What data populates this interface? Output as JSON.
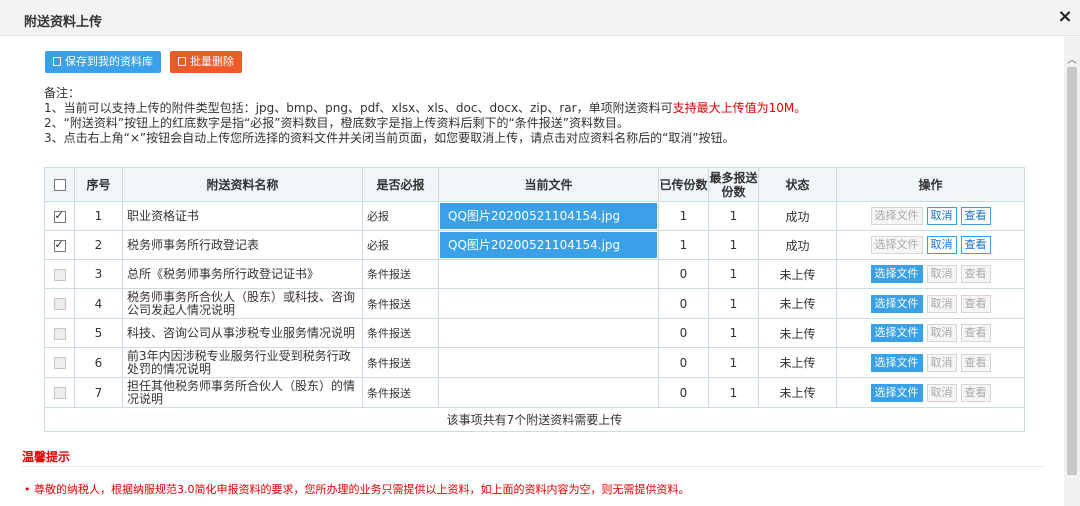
{
  "dialog": {
    "title": "附送资料上传",
    "close_glyph": "×"
  },
  "toolbar": {
    "save_label": "保存到我的资料库",
    "delete_label": "批量删除"
  },
  "notes": {
    "heading": "备注：",
    "line1_prefix": "1、当前可以支持上传的附件类型包括：jpg、bmp、png、pdf、xlsx、xls、doc、docx、zip、rar，单项附送资料可",
    "line1_highlight": "支持最大上传值为10M。",
    "line2": "2、“附送资料”按钮上的红底数字是指“必报”资料数目，橙底数字是指上传资料后剩下的“条件报送”资料数目。",
    "line3": "3、点击右上角“×”按钮会自动上传您所选择的资料文件并关闭当前页面，如您要取消上传，请点击对应资料名称后的“取消”按钮。"
  },
  "table": {
    "headers": {
      "seq": "序号",
      "name": "附送资料名称",
      "required": "是否必报",
      "current_file": "当前文件",
      "uploaded": "已传份数",
      "max": "最多报送份数",
      "status": "状态",
      "ops": "操作"
    },
    "rows": [
      {
        "seq": "1",
        "name": "职业资格证书",
        "required": "必报",
        "file": "QQ图片20200521104154.jpg",
        "uploaded": "1",
        "max": "1",
        "status": "成功",
        "op_select": "选择文件",
        "op_cancel": "取消",
        "op_view": "查看"
      },
      {
        "seq": "2",
        "name": "税务师事务所行政登记表",
        "required": "必报",
        "file": "QQ图片20200521104154.jpg",
        "uploaded": "1",
        "max": "1",
        "status": "成功",
        "op_select": "选择文件",
        "op_cancel": "取消",
        "op_view": "查看"
      },
      {
        "seq": "3",
        "name": "总所《税务师事务所行政登记证书》",
        "required": "条件报送",
        "file": "",
        "uploaded": "0",
        "max": "1",
        "status": "未上传",
        "op_select": "选择文件",
        "op_cancel": "取消",
        "op_view": "查看"
      },
      {
        "seq": "4",
        "name": "税务师事务所合伙人（股东）或科技、咨询公司发起人情况说明",
        "required": "条件报送",
        "file": "",
        "uploaded": "0",
        "max": "1",
        "status": "未上传",
        "op_select": "选择文件",
        "op_cancel": "取消",
        "op_view": "查看"
      },
      {
        "seq": "5",
        "name": "科技、咨询公司从事涉税专业服务情况说明",
        "required": "条件报送",
        "file": "",
        "uploaded": "0",
        "max": "1",
        "status": "未上传",
        "op_select": "选择文件",
        "op_cancel": "取消",
        "op_view": "查看"
      },
      {
        "seq": "6",
        "name": "前3年内因涉税专业服务行业受到税务行政处罚的情况说明",
        "required": "条件报送",
        "file": "",
        "uploaded": "0",
        "max": "1",
        "status": "未上传",
        "op_select": "选择文件",
        "op_cancel": "取消",
        "op_view": "查看"
      },
      {
        "seq": "7",
        "name": "担任其他税务师事务所合伙人（股东）的情况说明",
        "required": "条件报送",
        "file": "",
        "uploaded": "0",
        "max": "1",
        "status": "未上传",
        "op_select": "选择文件",
        "op_cancel": "取消",
        "op_view": "查看"
      }
    ],
    "summary": "该事项共有7个附送资料需要上传"
  },
  "tips": {
    "title": "温馨提示",
    "text": "• 尊敬的纳税人，根据纳服规范3.0简化申报资料的要求，您所办理的业务只需提供以上资料，如上面的资料内容为空，则无需提供资料。"
  },
  "colors": {
    "accent": "#3aa0e8",
    "danger": "#f05a28",
    "red_text": "#e60000"
  }
}
